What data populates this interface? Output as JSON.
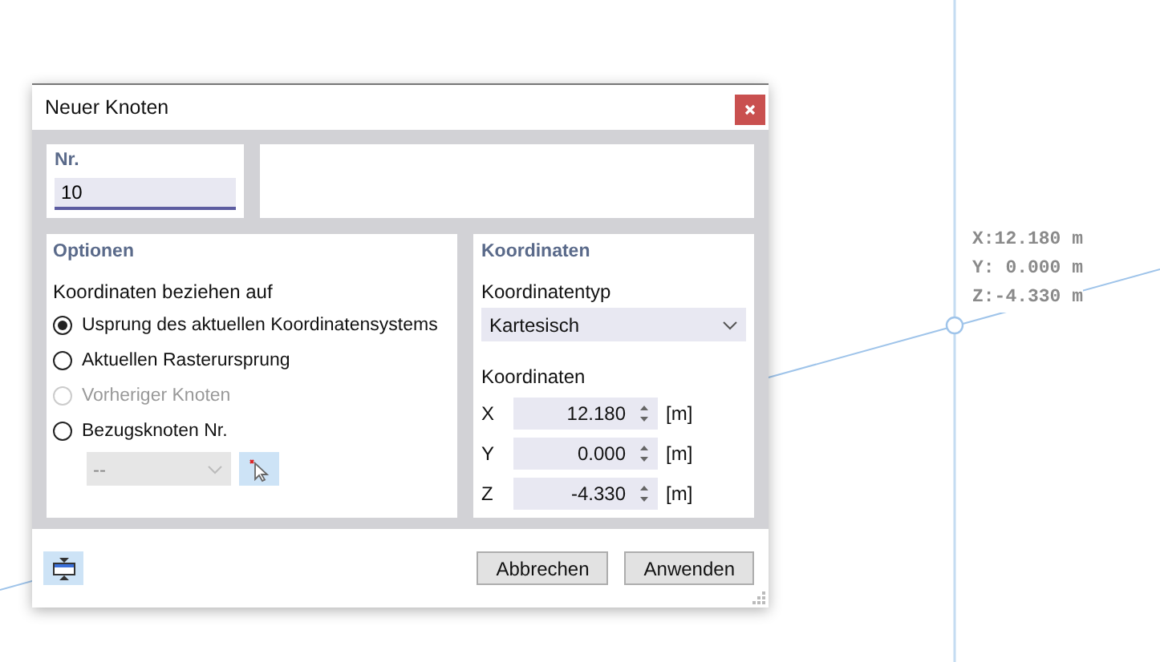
{
  "window": {
    "title": "Neuer Knoten"
  },
  "number": {
    "label": "Nr.",
    "value": "10"
  },
  "options": {
    "title": "Optionen",
    "subtitle": "Koordinaten beziehen auf",
    "radios": [
      {
        "label": "Usprung des aktuellen Koordinatensystems",
        "selected": true,
        "disabled": false
      },
      {
        "label": "Aktuellen Rasterursprung",
        "selected": false,
        "disabled": false
      },
      {
        "label": "Vorheriger Knoten",
        "selected": false,
        "disabled": true
      },
      {
        "label": "Bezugsknoten Nr.",
        "selected": false,
        "disabled": false
      }
    ],
    "reference": {
      "value": "--",
      "disabled": true
    }
  },
  "coordinates": {
    "title": "Koordinaten",
    "type_label": "Koordinatentyp",
    "type_value": "Kartesisch",
    "values_label": "Koordinaten",
    "rows": [
      {
        "axis": "X",
        "value": "12.180",
        "unit": "[m]"
      },
      {
        "axis": "Y",
        "value": "0.000",
        "unit": "[m]"
      },
      {
        "axis": "Z",
        "value": "-4.330",
        "unit": "[m]"
      }
    ]
  },
  "buttons": [
    "Abbrechen",
    "Anwenden"
  ],
  "readout": [
    "X:12.180 m",
    "Y: 0.000 m",
    "Z:-4.330 m"
  ]
}
